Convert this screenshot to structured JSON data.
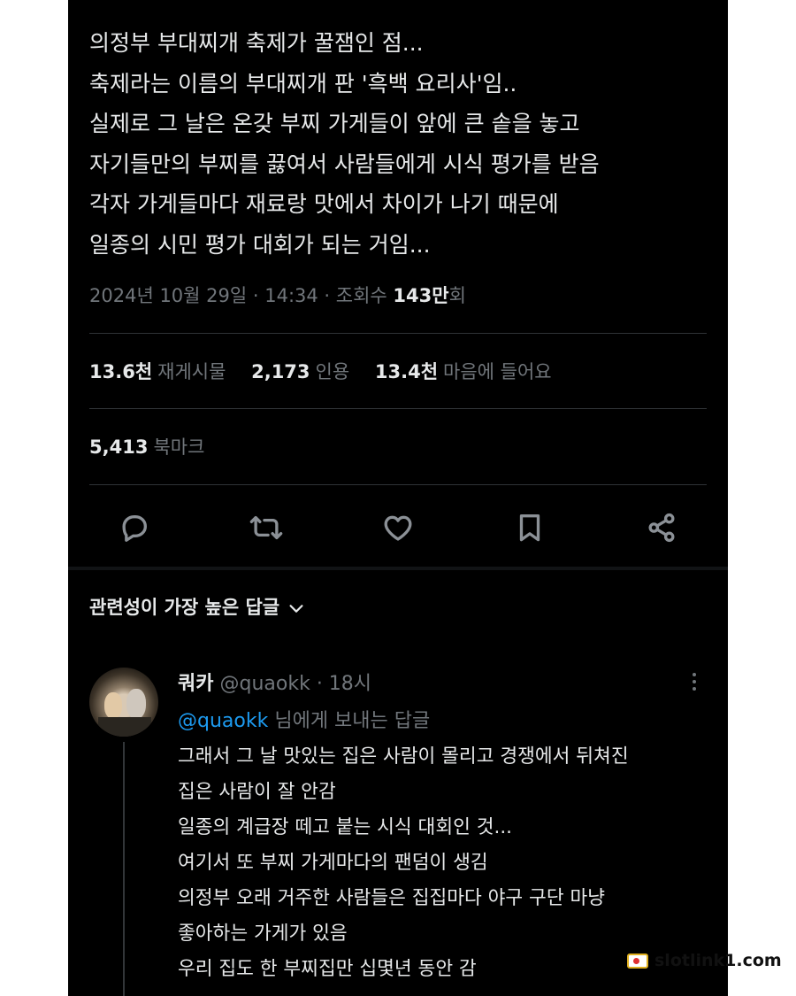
{
  "tweet": {
    "lines": [
      "의정부 부대찌개 축제가 꿀잼인 점...",
      "축제라는 이름의 부대찌개 판 '흑백 요리사'임..",
      "실제로 그 날은 온갖 부찌 가게들이 앞에 큰 솥을 놓고",
      "자기들만의 부찌를 끓여서 사람들에게 시식 평가를 받음",
      "각자 가게들마다 재료랑 맛에서 차이가 나기 때문에",
      "일종의 시민 평가 대회가 되는 거임..."
    ],
    "timestamp": "2024년 10월 29일 · 14:34 · 조회수 ",
    "views_count": "143만",
    "views_suffix": "회",
    "stats": {
      "retweets_count": "13.6천",
      "retweets_label": "재게시물",
      "quotes_count": "2,173",
      "quotes_label": "인용",
      "likes_count": "13.4천",
      "likes_label": "마음에 들어요",
      "bookmarks_count": "5,413",
      "bookmarks_label": "북마크"
    },
    "actions": {
      "reply_icon": "reply-icon",
      "retweet_icon": "retweet-icon",
      "like_icon": "heart-icon",
      "bookmark_icon": "bookmark-icon",
      "share_icon": "share-icon"
    }
  },
  "replies_sort": {
    "label": "관련성이 가장 높은 답글",
    "icon": "chevron-down-icon"
  },
  "reply": {
    "name": "쿼카",
    "handle": "@quaokk",
    "time": " · 18시",
    "replying_to_mention": "@quaokk",
    "replying_to_suffix": " 님에게 보내는 답글",
    "lines": [
      "그래서 그 날 맛있는 집은 사람이 몰리고 경쟁에서 뒤쳐진",
      "집은 사람이 잘 안감",
      "일종의 계급장 떼고 붙는 시식 대회인 것...",
      "여기서 또 부찌 가게마다의 팬덤이 생김",
      "의정부 오래 거주한 사람들은 집집마다 야구 구단 마냥",
      "좋아하는 가게가 있음",
      "우리 집도 한 부찌집만 십몇년 동안 감"
    ]
  },
  "watermark": {
    "text": "slotlink1.com"
  },
  "colors": {
    "background": "#000000",
    "text": "#e7e9ea",
    "secondary": "#71767b",
    "link": "#1d9bf0",
    "divider": "#2f3336"
  }
}
